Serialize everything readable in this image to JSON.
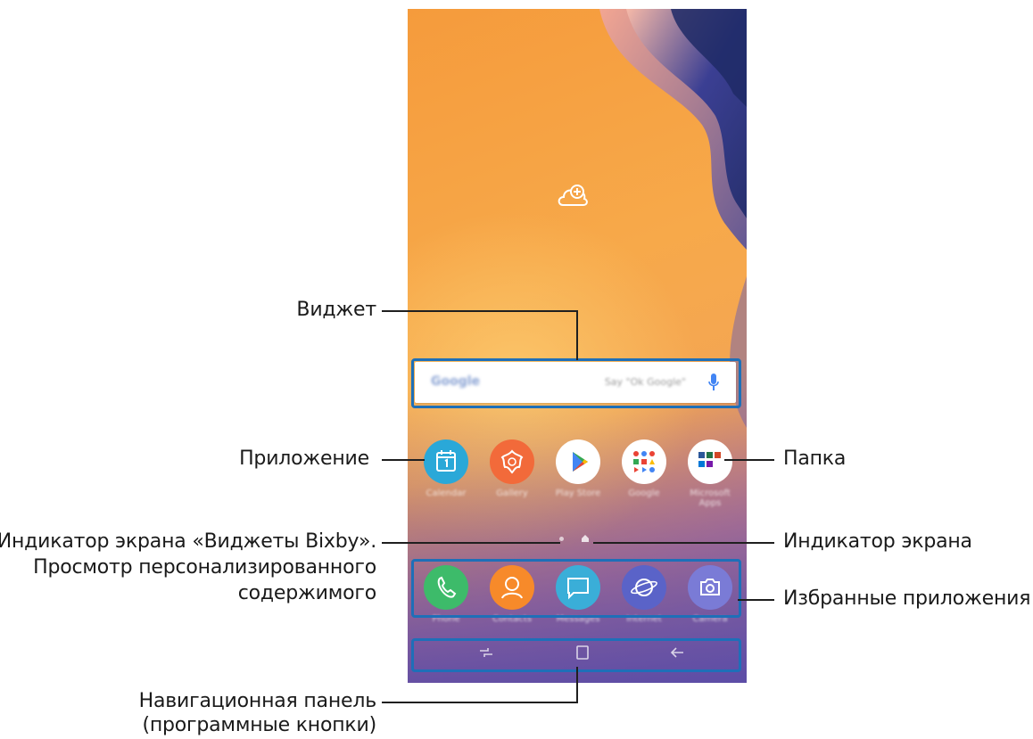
{
  "callouts": {
    "widget": "Виджет",
    "app": "Приложение",
    "folder": "Папка",
    "bixby_line1": "Индикатор экрана «Виджеты Bixby».",
    "bixby_line2": "Просмотр персонализированного",
    "bixby_line3": "содержимого",
    "screen_indicator": "Индикатор экрана",
    "favorites": "Избранные приложения",
    "nav_line1": "Навигационная панель",
    "nav_line2": "(программные кнопки)"
  },
  "home_screen": {
    "search_widget": {
      "brand": "Google",
      "placeholder": "Say \"Ok Google\"",
      "icon": "mic-icon"
    },
    "apps": [
      {
        "name": "Calendar",
        "icon": "calendar-icon",
        "color": "#2aa8d8"
      },
      {
        "name": "Gallery",
        "icon": "gallery-flower-icon",
        "color": "#f26a3a"
      },
      {
        "name": "Play Store",
        "icon": "play-store-icon",
        "color": "#ffffff"
      },
      {
        "name": "Google",
        "icon": "google-folder-icon",
        "color": "#ffffff"
      },
      {
        "name": "Microsoft Apps",
        "icon": "microsoft-folder-icon",
        "color": "#ffffff"
      }
    ],
    "dock": [
      {
        "name": "Phone",
        "icon": "phone-icon",
        "color": "#3dbb6a"
      },
      {
        "name": "Contacts",
        "icon": "contacts-icon",
        "color": "#f78a2a"
      },
      {
        "name": "Messages",
        "icon": "messages-icon",
        "color": "#3aaed8"
      },
      {
        "name": "Internet",
        "icon": "internet-icon",
        "color": "#5a63c8"
      },
      {
        "name": "Camera",
        "icon": "camera-icon",
        "color": "#7a7bd6"
      }
    ],
    "nav_buttons": [
      "recents-icon",
      "home-icon",
      "back-icon"
    ],
    "accent_color": "#1e6fb8"
  }
}
